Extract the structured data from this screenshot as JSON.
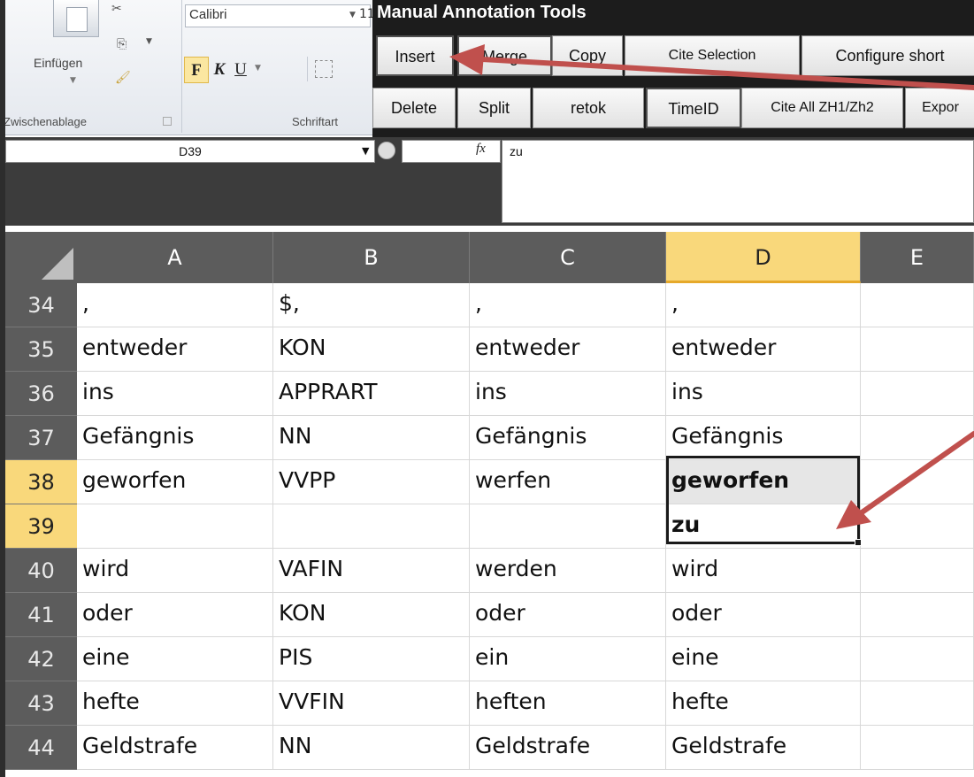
{
  "ribbon": {
    "paste_label": "Einfügen",
    "clipboard_group": "Zwischenablage",
    "font_group": "Schriftart",
    "font_name": "Calibri",
    "font_size": "11",
    "bold": "F",
    "italic": "K",
    "underline": "U"
  },
  "annotation_panel": {
    "title": "Manual Annotation Tools",
    "row1": [
      "Insert",
      "Merge",
      "Copy",
      "Cite Selection",
      "Configure short"
    ],
    "row2": [
      "Delete",
      "Split",
      "retok",
      "TimeID",
      "Cite All ZH1/Zh2",
      "Expor"
    ]
  },
  "formula_bar": {
    "name_box": "D39",
    "fx": "fx",
    "content": "zu"
  },
  "columns": [
    "A",
    "B",
    "C",
    "D",
    "E"
  ],
  "selected_column": "D",
  "rows": [
    {
      "num": "34",
      "cells": [
        ",",
        "$,",
        ",",
        ","
      ]
    },
    {
      "num": "35",
      "cells": [
        "entweder",
        "KON",
        "entweder",
        "entweder"
      ]
    },
    {
      "num": "36",
      "cells": [
        "ins",
        "APPRART",
        "ins",
        "ins"
      ]
    },
    {
      "num": "37",
      "cells": [
        "Gefängnis",
        "NN",
        "Gefängnis",
        "Gefängnis"
      ]
    },
    {
      "num": "38",
      "cells": [
        "geworfen",
        "VVPP",
        "werfen",
        "geworfen"
      ]
    },
    {
      "num": "39",
      "cells": [
        "",
        "",
        "",
        "zu"
      ]
    },
    {
      "num": "40",
      "cells": [
        "wird",
        "VAFIN",
        "werden",
        "wird"
      ]
    },
    {
      "num": "41",
      "cells": [
        "oder",
        "KON",
        "oder",
        "oder"
      ]
    },
    {
      "num": "42",
      "cells": [
        "eine",
        "PIS",
        "ein",
        "eine"
      ]
    },
    {
      "num": "43",
      "cells": [
        "hefte",
        "VVFIN",
        "heften",
        "hefte"
      ]
    },
    {
      "num": "44",
      "cells": [
        "Geldstrafe",
        "NN",
        "Geldstrafe",
        "Geldstrafe"
      ]
    }
  ],
  "selected_rows": [
    "38",
    "39"
  ],
  "colors": {
    "arrow": "#c0504d",
    "selected_header": "#f9d87b",
    "header_bg": "#5c5c5c",
    "panel_bg": "#1c1c1c"
  }
}
